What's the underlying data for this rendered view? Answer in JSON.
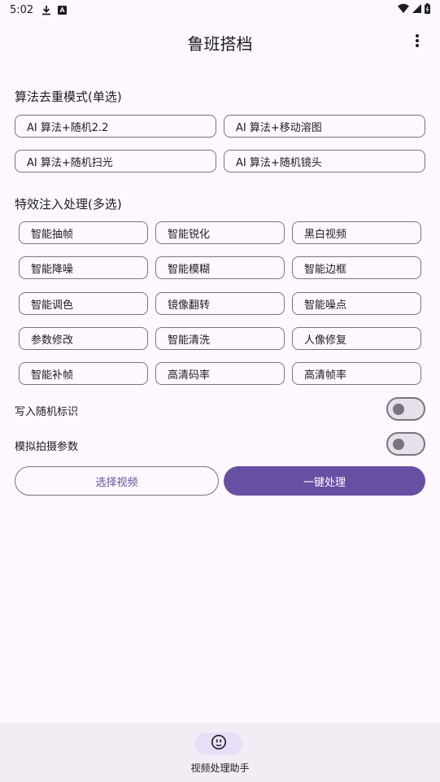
{
  "status_bar": {
    "time": "5:02"
  },
  "app_bar": {
    "title": "鲁班搭档"
  },
  "mode_section": {
    "title": "算法去重模式(单选)",
    "options": [
      "AI 算法+随机2.2",
      "AI 算法+移动溶图",
      "AI 算法+随机扫光",
      "AI 算法+随机镜头"
    ]
  },
  "effects_section": {
    "title": "特效注入处理(多选)",
    "options": [
      "智能抽帧",
      "智能锐化",
      "黑白视频",
      "智能降噪",
      "智能模糊",
      "智能边框",
      "智能调色",
      "镜像翻转",
      "智能噪点",
      "参数修改",
      "智能清洗",
      "人像修复",
      "智能补帧",
      "高清码率",
      "高清帧率"
    ]
  },
  "toggles": [
    {
      "label": "写入随机标识",
      "on": false
    },
    {
      "label": "模拟拍摄参数",
      "on": false
    }
  ],
  "actions": {
    "select_video": "选择视频",
    "process": "一键处理"
  },
  "bottom_nav": {
    "items": [
      {
        "label": "视频处理助手",
        "icon": "face-icon"
      }
    ]
  },
  "colors": {
    "primary": "#6750a4",
    "background": "#fdf8fd",
    "outline": "#79747e",
    "nav_background": "#f2ecf4",
    "nav_indicator": "#e8def8"
  }
}
